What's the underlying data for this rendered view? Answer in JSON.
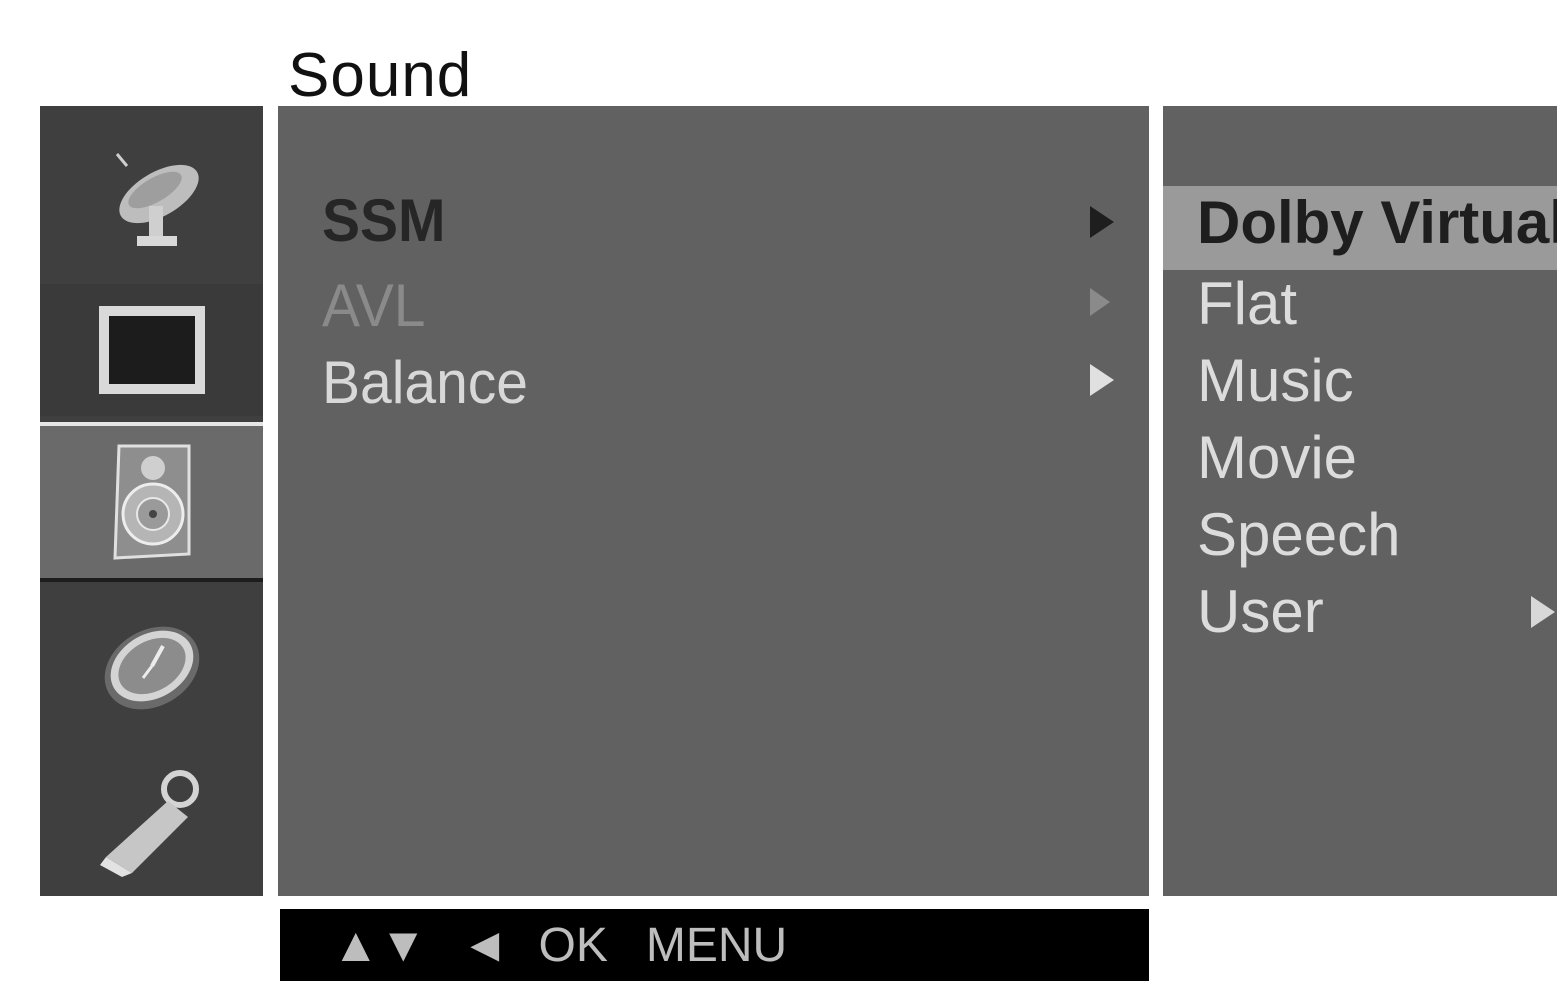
{
  "menu_title": "Sound",
  "sidebar": {
    "icons": [
      {
        "name": "satellite-dish-icon",
        "label": "Station"
      },
      {
        "name": "picture-icon",
        "label": "Picture"
      },
      {
        "name": "speaker-icon",
        "label": "Sound",
        "selected": true
      },
      {
        "name": "clock-icon",
        "label": "Time"
      },
      {
        "name": "key-icon",
        "label": "Special"
      }
    ]
  },
  "main_menu": {
    "items": [
      {
        "label": "SSM",
        "state": "highlighted"
      },
      {
        "label": "AVL",
        "state": "dim"
      },
      {
        "label": "Balance",
        "state": "normal"
      }
    ]
  },
  "submenu": {
    "items": [
      {
        "label": "Dolby Virtual",
        "selected": true
      },
      {
        "label": "Flat"
      },
      {
        "label": "Music"
      },
      {
        "label": "Movie"
      },
      {
        "label": "Speech"
      },
      {
        "label": "User",
        "has_arrow": true
      }
    ]
  },
  "nav_bar": {
    "updown": "▲▼",
    "left": "◄",
    "ok": "OK",
    "menu": "MENU"
  },
  "colors": {
    "panel": "#616161",
    "sidebar": "#3f3f3f",
    "submenu_highlight": "#9a9a9a",
    "nav_bar": "#000000"
  }
}
